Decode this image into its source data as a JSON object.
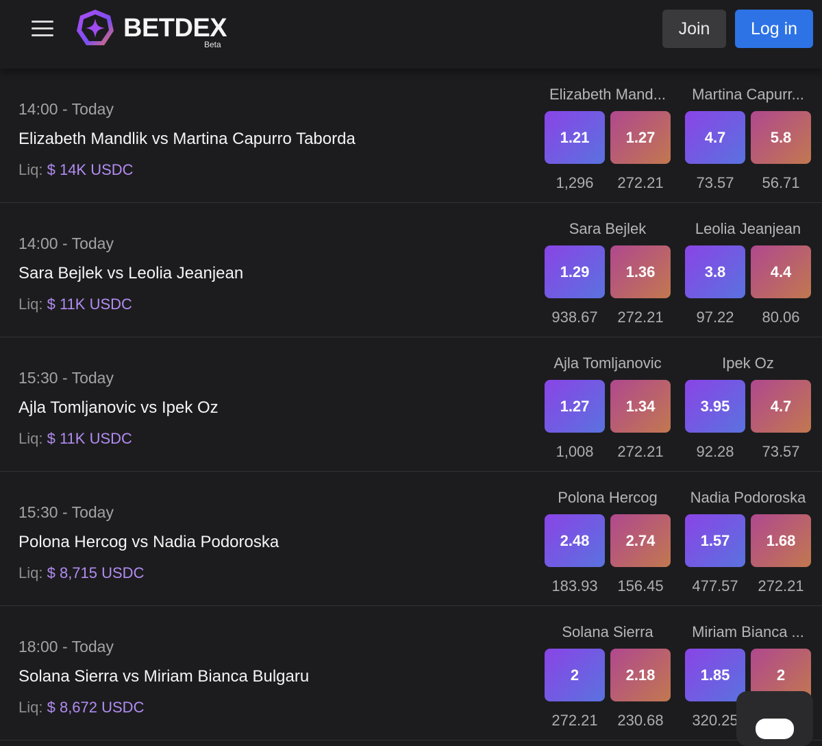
{
  "header": {
    "logo_text": "BETDEX",
    "logo_tag": "Beta",
    "join_label": "Join",
    "login_label": "Log in"
  },
  "colors": {
    "background": "#1c1c1e",
    "login_button": "#2d73e6",
    "back_gradient": [
      "#8a44e6",
      "#5a72df"
    ],
    "lay_gradient": [
      "#b0488f",
      "#c2784f"
    ],
    "liquidity_amount": "#b28cf2"
  },
  "events": [
    {
      "time": "14:00 - Today",
      "title": "Elizabeth Mandlik vs Martina Capurro Taborda",
      "liq_label": "Liq:",
      "liq_amount": "$ 14K USDC",
      "sel_a": "Elizabeth Mand...",
      "sel_b": "Martina Capurr...",
      "odds": [
        "1.21",
        "1.27",
        "4.7",
        "5.8"
      ],
      "stakes": [
        "1,296",
        "272.21",
        "73.57",
        "56.71"
      ]
    },
    {
      "time": "14:00 - Today",
      "title": "Sara Bejlek vs Leolia Jeanjean",
      "liq_label": "Liq:",
      "liq_amount": "$ 11K USDC",
      "sel_a": "Sara Bejlek",
      "sel_b": "Leolia Jeanjean",
      "odds": [
        "1.29",
        "1.36",
        "3.8",
        "4.4"
      ],
      "stakes": [
        "938.67",
        "272.21",
        "97.22",
        "80.06"
      ]
    },
    {
      "time": "15:30 - Today",
      "title": "Ajla Tomljanovic vs Ipek Oz",
      "liq_label": "Liq:",
      "liq_amount": "$ 11K USDC",
      "sel_a": "Ajla Tomljanovic",
      "sel_b": "Ipek Oz",
      "odds": [
        "1.27",
        "1.34",
        "3.95",
        "4.7"
      ],
      "stakes": [
        "1,008",
        "272.21",
        "92.28",
        "73.57"
      ]
    },
    {
      "time": "15:30 - Today",
      "title": "Polona Hercog vs Nadia Podoroska",
      "liq_label": "Liq:",
      "liq_amount": "$ 8,715 USDC",
      "sel_a": "Polona Hercog",
      "sel_b": "Nadia Podoroska",
      "odds": [
        "2.48",
        "2.74",
        "1.57",
        "1.68"
      ],
      "stakes": [
        "183.93",
        "156.45",
        "477.57",
        "272.21"
      ]
    },
    {
      "time": "18:00 - Today",
      "title": "Solana Sierra vs Miriam Bianca Bulgaru",
      "liq_label": "Liq:",
      "liq_amount": "$ 8,672 USDC",
      "sel_a": "Solana Sierra",
      "sel_b": "Miriam Bianca ...",
      "odds": [
        "2",
        "2.18",
        "1.85",
        "2"
      ],
      "stakes": [
        "272.21",
        "230.68",
        "320.25",
        ""
      ]
    }
  ]
}
